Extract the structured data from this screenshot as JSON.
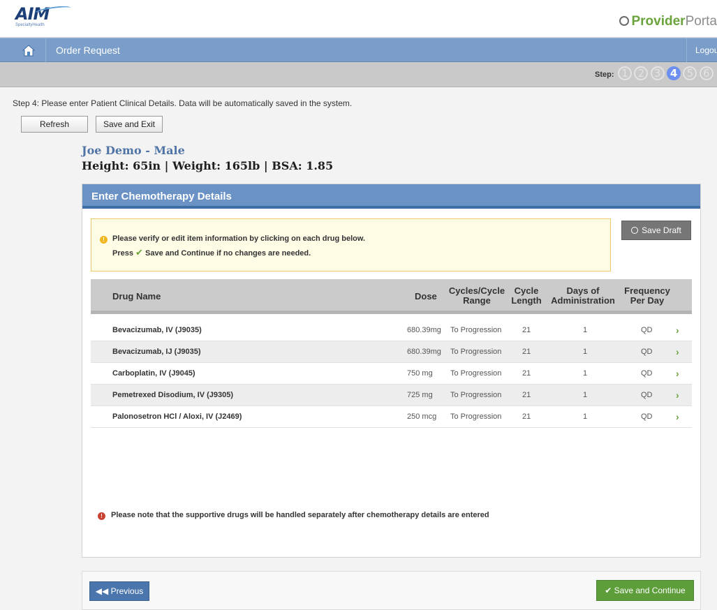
{
  "header": {
    "logo_text": "AIM",
    "logo_subtext": "SpecialtyHealth",
    "portal_bold": "Provider",
    "portal_rest": "Porta"
  },
  "nav": {
    "title": "Order Request",
    "logout": "Logout"
  },
  "steps": {
    "label": "Step:",
    "items": [
      "1",
      "2",
      "3",
      "4",
      "5",
      "6"
    ],
    "active": 4
  },
  "instructions": "Step 4:  Please enter Patient Clinical Details.  Data will be automatically saved in the system.",
  "buttons": {
    "refresh": "Refresh",
    "save_exit": "Save and Exit",
    "save_draft": "Save Draft",
    "previous": "Previous",
    "save_continue": "Save and Continue"
  },
  "patient": {
    "name": "Joe Demo  - Male",
    "stats": "Height: 65in  |  Weight: 165lb  |  BSA: 1.85"
  },
  "panel": {
    "title": "Enter Chemotherapy Details",
    "notice_line1": "Please verify or edit item information by clicking on each drug below.",
    "notice_line2_prefix": "Press",
    "notice_line2_suffix": "Save and Continue if no changes are needed.",
    "note": "Please note that the supportive drugs will be handled separately after chemotherapy details are entered"
  },
  "table": {
    "columns": {
      "drug": "Drug Name",
      "dose": "Dose",
      "cycles_a": "Cycles/Cycle",
      "cycles_b": "Range",
      "length_a": "Cycle",
      "length_b": "Length",
      "days_a": "Days of",
      "days_b": "Administration",
      "freq_a": "Frequency",
      "freq_b": "Per Day"
    },
    "rows": [
      {
        "drug": "Bevacizumab, IV (J9035)",
        "dose": "680.39mg",
        "cycles": "To Progression",
        "length": "21",
        "days": "1",
        "freq": "QD"
      },
      {
        "drug": "Bevacizumab, IJ (J9035)",
        "dose": "680.39mg",
        "cycles": "To Progression",
        "length": "21",
        "days": "1",
        "freq": "QD"
      },
      {
        "drug": "Carboplatin, IV (J9045)",
        "dose": "750  mg",
        "cycles": "To Progression",
        "length": "21",
        "days": "1",
        "freq": "QD"
      },
      {
        "drug": "Pemetrexed Disodium, IV (J9305)",
        "dose": "725  mg",
        "cycles": "To Progression",
        "length": "21",
        "days": "1",
        "freq": "QD"
      },
      {
        "drug": "Palonosetron HCl / Aloxi, IV (J2469)",
        "dose": "250  mcg",
        "cycles": "To Progression",
        "length": "21",
        "days": "1",
        "freq": "QD"
      }
    ]
  },
  "colors": {
    "nav_blue": "#7a9ec9",
    "panel_header": "#6b92c5",
    "accent_green": "#5d9d3a",
    "step_active": "#6d90f0"
  }
}
